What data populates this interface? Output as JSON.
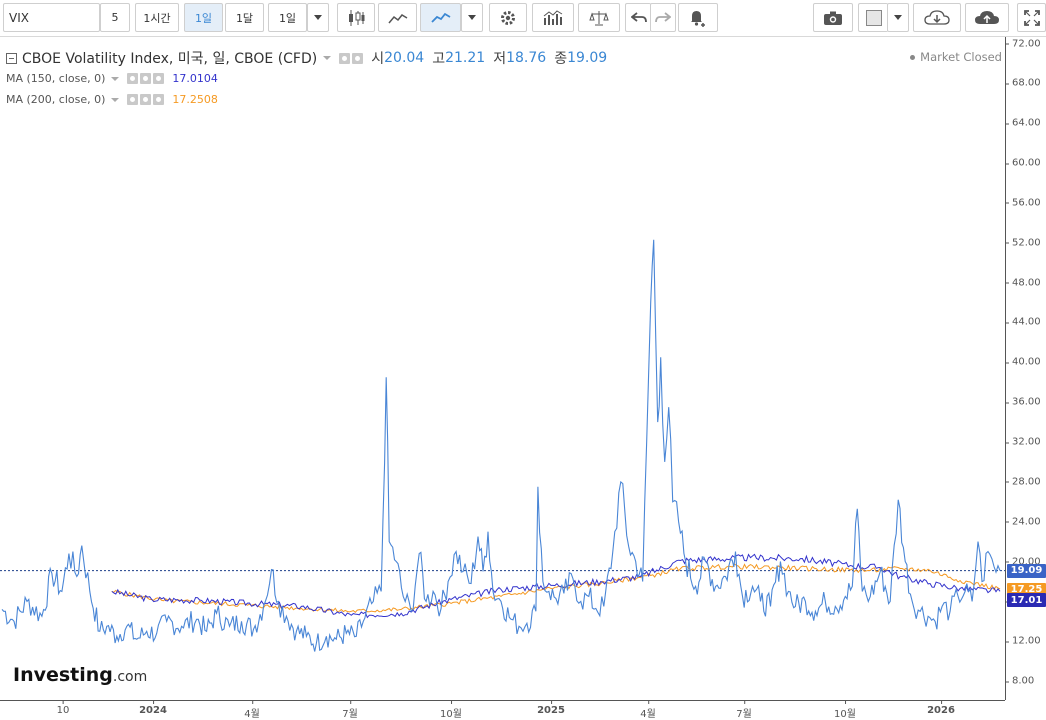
{
  "toolbar": {
    "symbol": "VIX",
    "buttons": [
      {
        "name": "interval-5-button",
        "label": "5"
      },
      {
        "name": "interval-1h-button",
        "label": "1시간"
      },
      {
        "name": "interval-1d-button",
        "label": "1일",
        "active": true
      },
      {
        "name": "interval-1mo-button",
        "label": "1달"
      },
      {
        "name": "interval-custom-button",
        "label": "1일"
      }
    ],
    "icons": [
      "candlestick-icon",
      "area-chart-icon",
      "line-chart-icon",
      "settings-gear-icon",
      "indicators-icon",
      "compare-scale-icon",
      "undo-icon",
      "redo-icon",
      "alert-bell-icon",
      "camera-icon",
      "color-swatch-icon",
      "cloud-download-icon",
      "cloud-upload-icon",
      "fullscreen-icon"
    ]
  },
  "legend": {
    "title": "CBOE Volatility Index, 미국, 일, CBOE (CFD)",
    "open_label": "시",
    "open": "20.04",
    "high_label": "고",
    "high": "21.21",
    "low_label": "저",
    "low": "18.76",
    "close_label": "종",
    "close": "19.09",
    "ma150": {
      "label": "MA (150, close, 0)",
      "value": "17.0104",
      "color": "#3333cc"
    },
    "ma200": {
      "label": "MA (200, close, 0)",
      "value": "17.2508",
      "color": "#f59a23"
    }
  },
  "market_status": "Market Closed",
  "price_tags": {
    "last": "19.09",
    "ma200": "17.25",
    "ma150": "17.01"
  },
  "logo": {
    "main": "Investing",
    "suffix": ".com"
  },
  "chart_data": {
    "type": "line",
    "series": [
      {
        "name": "CBOE Volatility Index",
        "color": "#4a86d6",
        "anchors": [
          [
            0.0,
            15.2
          ],
          [
            0.012,
            14
          ],
          [
            0.025,
            16
          ],
          [
            0.04,
            14.5
          ],
          [
            0.05,
            18.8
          ],
          [
            0.06,
            17
          ],
          [
            0.067,
            20.8
          ],
          [
            0.075,
            18.5
          ],
          [
            0.08,
            21.6
          ],
          [
            0.088,
            17
          ],
          [
            0.098,
            13
          ],
          [
            0.105,
            13.5
          ],
          [
            0.115,
            12.5
          ],
          [
            0.125,
            13.5
          ],
          [
            0.135,
            12.2
          ],
          [
            0.145,
            13
          ],
          [
            0.155,
            12.8
          ],
          [
            0.165,
            14
          ],
          [
            0.18,
            13.5
          ],
          [
            0.195,
            14.2
          ],
          [
            0.205,
            13
          ],
          [
            0.215,
            14.8
          ],
          [
            0.228,
            13.5
          ],
          [
            0.24,
            14
          ],
          [
            0.252,
            13.2
          ],
          [
            0.262,
            15.5
          ],
          [
            0.27,
            19.2
          ],
          [
            0.277,
            16
          ],
          [
            0.285,
            14.5
          ],
          [
            0.295,
            13
          ],
          [
            0.305,
            12.5
          ],
          [
            0.315,
            11.8
          ],
          [
            0.325,
            12.5
          ],
          [
            0.335,
            12.2
          ],
          [
            0.345,
            12.8
          ],
          [
            0.355,
            12.5
          ],
          [
            0.362,
            14
          ],
          [
            0.372,
            16
          ],
          [
            0.38,
            17
          ],
          [
            0.385,
            38.5
          ],
          [
            0.388,
            22
          ],
          [
            0.395,
            20
          ],
          [
            0.402,
            16.5
          ],
          [
            0.41,
            15
          ],
          [
            0.418,
            20.8
          ],
          [
            0.425,
            16
          ],
          [
            0.432,
            17
          ],
          [
            0.44,
            15.3
          ],
          [
            0.447,
            18
          ],
          [
            0.455,
            21
          ],
          [
            0.462,
            19
          ],
          [
            0.47,
            17.8
          ],
          [
            0.477,
            22.5
          ],
          [
            0.482,
            19
          ],
          [
            0.487,
            23
          ],
          [
            0.492,
            17
          ],
          [
            0.5,
            16
          ],
          [
            0.51,
            14.2
          ],
          [
            0.518,
            13.5
          ],
          [
            0.526,
            13.8
          ],
          [
            0.535,
            15
          ],
          [
            0.537,
            27.5
          ],
          [
            0.542,
            18
          ],
          [
            0.548,
            17
          ],
          [
            0.555,
            16.3
          ],
          [
            0.563,
            16.8
          ],
          [
            0.572,
            18.3
          ],
          [
            0.58,
            16
          ],
          [
            0.588,
            16.5
          ],
          [
            0.595,
            15.3
          ],
          [
            0.603,
            15.5
          ],
          [
            0.612,
            21
          ],
          [
            0.62,
            28
          ],
          [
            0.628,
            21.5
          ],
          [
            0.635,
            20
          ],
          [
            0.642,
            18
          ],
          [
            0.65,
            46
          ],
          [
            0.653,
            52.3
          ],
          [
            0.657,
            34
          ],
          [
            0.66,
            40.5
          ],
          [
            0.664,
            30
          ],
          [
            0.668,
            35.5
          ],
          [
            0.672,
            26
          ],
          [
            0.678,
            24
          ],
          [
            0.685,
            20
          ],
          [
            0.695,
            17.5
          ],
          [
            0.705,
            20
          ],
          [
            0.715,
            17.5
          ],
          [
            0.725,
            18.5
          ],
          [
            0.735,
            21
          ],
          [
            0.742,
            16.5
          ],
          [
            0.752,
            17.5
          ],
          [
            0.76,
            16
          ],
          [
            0.77,
            15.5
          ],
          [
            0.78,
            20
          ],
          [
            0.788,
            17
          ],
          [
            0.795,
            15.5
          ],
          [
            0.805,
            16
          ],
          [
            0.815,
            15
          ],
          [
            0.825,
            16
          ],
          [
            0.835,
            15.5
          ],
          [
            0.845,
            16.5
          ],
          [
            0.852,
            17.5
          ],
          [
            0.857,
            25.3
          ],
          [
            0.862,
            17
          ],
          [
            0.87,
            16.5
          ],
          [
            0.88,
            19
          ],
          [
            0.89,
            16
          ],
          [
            0.898,
            26.2
          ],
          [
            0.905,
            20
          ],
          [
            0.912,
            16
          ],
          [
            0.92,
            15
          ],
          [
            0.928,
            14.5
          ],
          [
            0.935,
            14
          ],
          [
            0.942,
            15.5
          ],
          [
            0.95,
            15
          ],
          [
            0.958,
            16.5
          ],
          [
            0.965,
            17
          ],
          [
            0.972,
            16
          ],
          [
            0.978,
            22
          ],
          [
            0.982,
            18
          ],
          [
            0.988,
            21
          ],
          [
            0.994,
            19.5
          ],
          [
            1.0,
            19.09
          ]
        ]
      },
      {
        "name": "MA (150, close, 0)",
        "color": "#3333cc",
        "anchors": [
          [
            0.11,
            17.0
          ],
          [
            0.15,
            16.2
          ],
          [
            0.2,
            16.1
          ],
          [
            0.3,
            15.5
          ],
          [
            0.35,
            14.6
          ],
          [
            0.4,
            14.8
          ],
          [
            0.45,
            16.2
          ],
          [
            0.5,
            17.2
          ],
          [
            0.55,
            17.6
          ],
          [
            0.6,
            18.0
          ],
          [
            0.64,
            18.5
          ],
          [
            0.68,
            20.1
          ],
          [
            0.75,
            20.4
          ],
          [
            0.8,
            20.3
          ],
          [
            0.85,
            19.6
          ],
          [
            0.88,
            19.4
          ],
          [
            0.9,
            18.5
          ],
          [
            0.93,
            17.8
          ],
          [
            0.96,
            17.3
          ],
          [
            1.0,
            17.0104
          ]
        ]
      },
      {
        "name": "MA (200, close, 0)",
        "color": "#f59a23",
        "anchors": [
          [
            0.11,
            17.0
          ],
          [
            0.16,
            16.1
          ],
          [
            0.25,
            15.6
          ],
          [
            0.3,
            15.3
          ],
          [
            0.35,
            15.0
          ],
          [
            0.4,
            15.2
          ],
          [
            0.45,
            15.8
          ],
          [
            0.5,
            16.5
          ],
          [
            0.55,
            17.3
          ],
          [
            0.6,
            17.8
          ],
          [
            0.65,
            18.6
          ],
          [
            0.68,
            19.3
          ],
          [
            0.73,
            19.5
          ],
          [
            0.78,
            19.4
          ],
          [
            0.83,
            19.2
          ],
          [
            0.87,
            19.1
          ],
          [
            0.9,
            19.3
          ],
          [
            0.93,
            19.1
          ],
          [
            0.96,
            18.1
          ],
          [
            1.0,
            17.2508
          ]
        ]
      }
    ],
    "x_tick_labels": [
      "10",
      "2024",
      "4월",
      "7월",
      "10월",
      "2025",
      "4월",
      "7월",
      "10월",
      "2026"
    ],
    "y_tick_labels": [
      "8.00",
      "12.00",
      "16.00",
      "20.00",
      "24.00",
      "28.00",
      "32.00",
      "36.00",
      "40.00",
      "44.00",
      "48.00",
      "52.00",
      "56.00",
      "60.00",
      "64.00",
      "68.00",
      "72.00"
    ],
    "ylim": [
      8,
      72
    ],
    "last_value_line": 19.09,
    "grid": false
  }
}
